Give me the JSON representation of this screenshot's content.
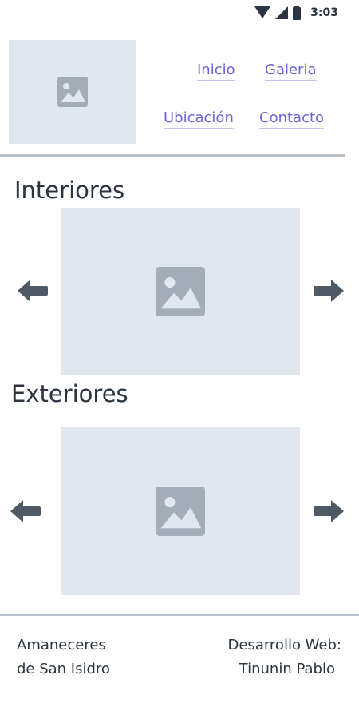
{
  "status_bar": {
    "time": "3:03",
    "icons": [
      "wifi-icon",
      "signal-icon",
      "battery-icon"
    ]
  },
  "header": {
    "logo_icon": "image-placeholder-icon",
    "nav": {
      "inicio": "Inicio",
      "galeria": "Galeria",
      "ubicacion": "Ubicación",
      "contacto": "Contacto"
    }
  },
  "sections": {
    "interiores": {
      "title": "Interiores",
      "prev_icon": "arrow-left-icon",
      "next_icon": "arrow-right-icon",
      "image_icon": "image-placeholder-icon"
    },
    "exteriores": {
      "title": "Exteriores",
      "prev_icon": "arrow-left-icon",
      "next_icon": "arrow-right-icon",
      "image_icon": "image-placeholder-icon"
    }
  },
  "footer": {
    "left_line1": "Amaneceres",
    "left_line2": "de San Isidro",
    "right_line1": "Desarrollo Web:",
    "right_line2": "Tinunin Pablo"
  },
  "colors": {
    "link": "#6c5fe0",
    "placeholder_bg": "#e1e7ee",
    "icon": "#a3adb8",
    "arrow": "#4d5a66",
    "divider": "#b8c1c9"
  }
}
